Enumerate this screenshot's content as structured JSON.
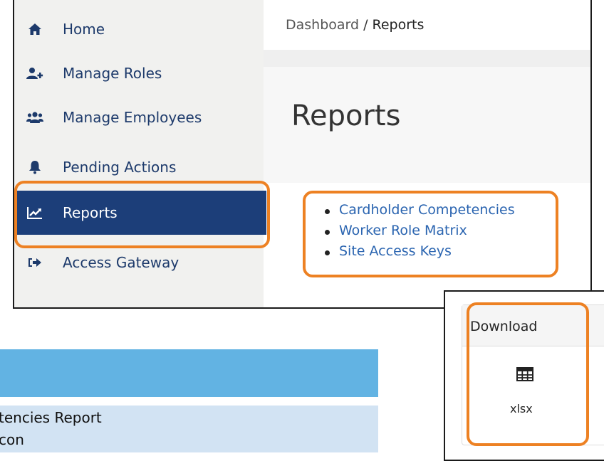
{
  "sidebar": {
    "items": [
      {
        "label": "Home",
        "icon": "home-icon",
        "active": false
      },
      {
        "label": "Manage Roles",
        "icon": "user-plus-icon",
        "active": false
      },
      {
        "label": "Manage Employees",
        "icon": "users-icon",
        "active": false
      },
      {
        "label": "Pending Actions",
        "icon": "bell-icon",
        "active": false
      },
      {
        "label": "Reports",
        "icon": "line-chart-icon",
        "active": true
      },
      {
        "label": "Access Gateway",
        "icon": "sign-out-icon",
        "active": false
      }
    ]
  },
  "breadcrumb": {
    "root": "Dashboard",
    "separator": "/",
    "current": "Reports"
  },
  "page": {
    "title": "Reports"
  },
  "reports": {
    "links": [
      "Cardholder Competencies",
      "Worker Role Matrix",
      "Site Access Keys"
    ]
  },
  "download": {
    "title": "Download",
    "format": "xlsx",
    "icon": "table-icon"
  },
  "table_fragment": {
    "row1": "tencies Report",
    "row2": "con"
  },
  "colors": {
    "sidebar_bg": "#f1f1ef",
    "active_bg": "#1c3e79",
    "link": "#2a64b0",
    "highlight": "#ed8123",
    "header_blue": "#62b3e3",
    "row_light_blue": "#d2e3f3"
  }
}
